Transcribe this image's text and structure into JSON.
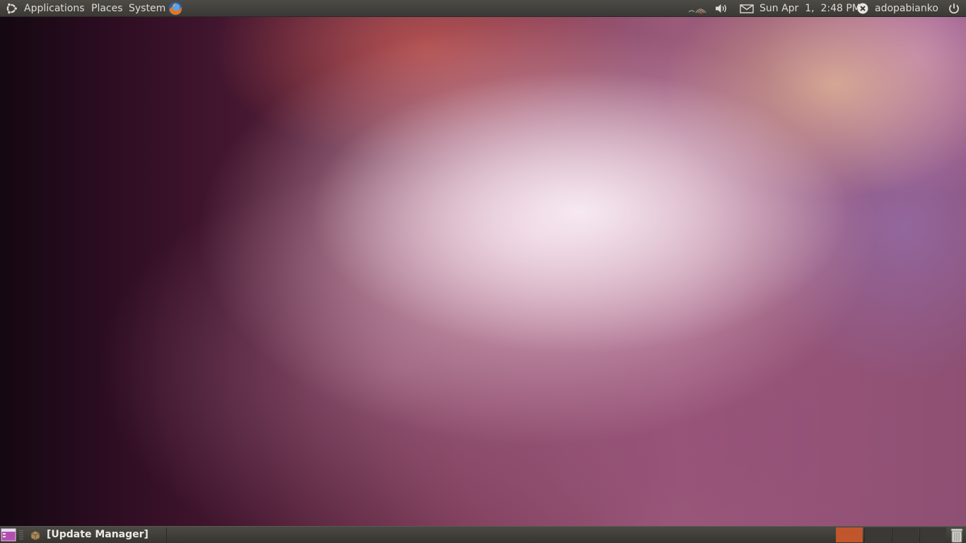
{
  "top_panel": {
    "menus": {
      "applications": "Applications",
      "places": "Places",
      "system": "System"
    },
    "launchers": [
      "firefox-icon"
    ],
    "indicators": [
      "network-icon",
      "volume-icon",
      "mail-icon"
    ],
    "clock": "Sun Apr  1,  2:48 PM",
    "user": "adopabianko",
    "session_icon": "power-icon"
  },
  "bottom_panel": {
    "taskbar": [
      {
        "label": "[Update Manager]",
        "icon": "package-icon"
      }
    ],
    "workspaces": {
      "count": 4,
      "active_index": 0
    },
    "trash_icon": "trash-icon"
  },
  "colors": {
    "panel": "#3c3b37",
    "panel_text": "#dfdbd2",
    "workspace_active": "#c0562b",
    "workspace_inactive": "#3a3935",
    "accent": "#dd4814"
  }
}
